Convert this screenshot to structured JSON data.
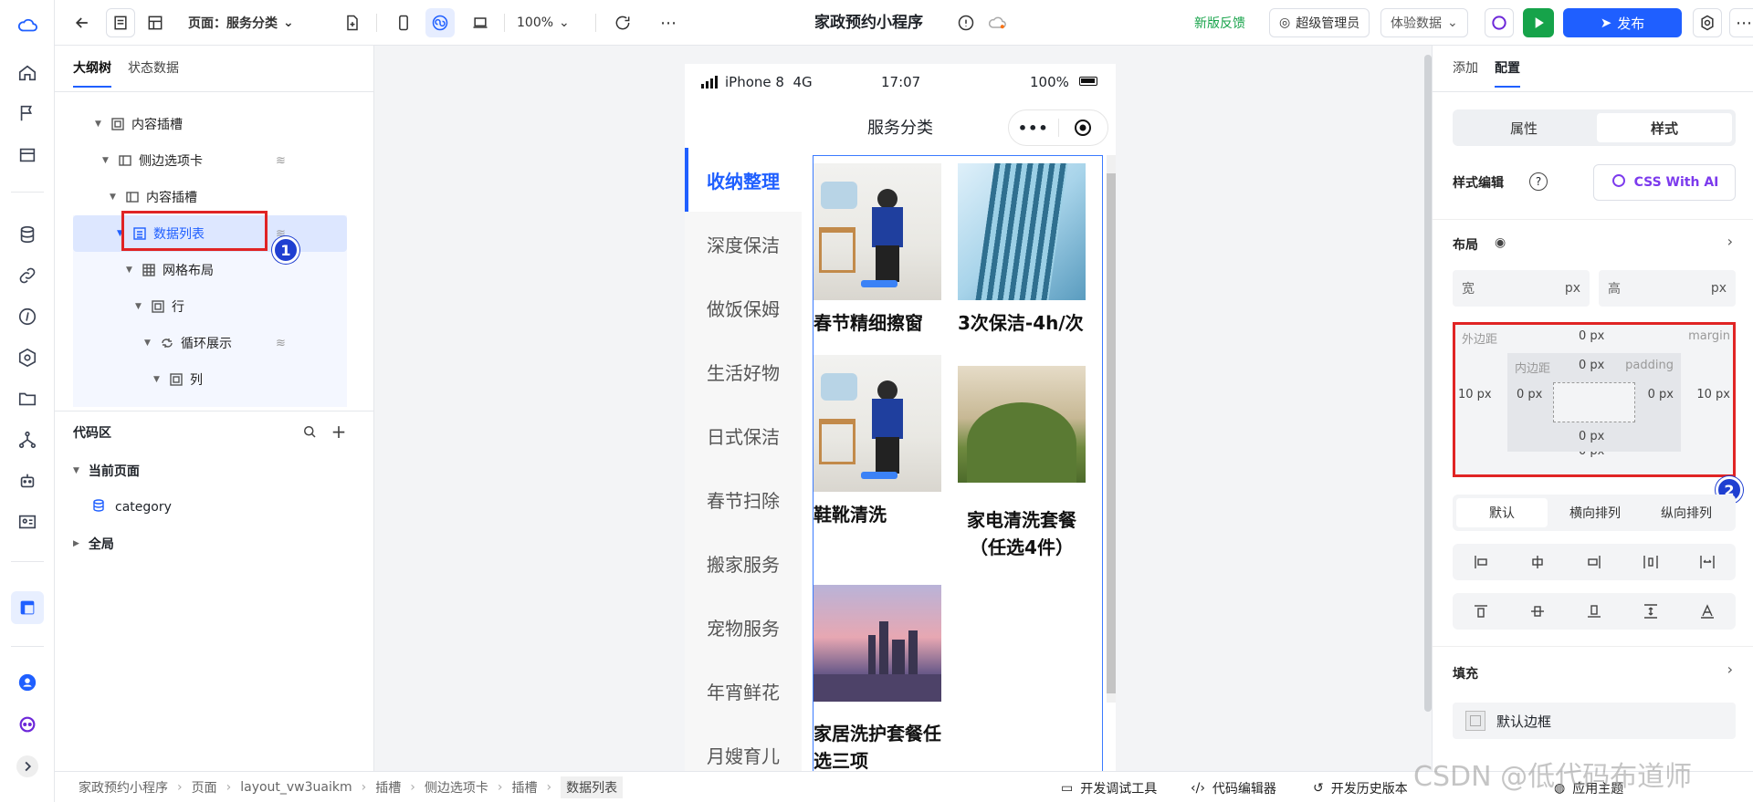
{
  "topbar": {
    "page_selector": "页面：服务分类",
    "zoom": "100%",
    "title": "家政预约小程序",
    "feedback": "新版反馈",
    "role": "超级管理员",
    "data_mode": "体验数据",
    "publish": "发布"
  },
  "left": {
    "tabs": [
      "大纲树",
      "状态数据"
    ],
    "tree": [
      {
        "label": "内容插槽",
        "icon": "slot-icon"
      },
      {
        "label": "侧边选项卡",
        "icon": "tabs-icon",
        "db": true
      },
      {
        "label": "内容插槽",
        "icon": "tabs-icon"
      },
      {
        "label": "数据列表",
        "icon": "list-icon",
        "db": true,
        "selected": true
      },
      {
        "label": "网格布局",
        "icon": "grid-icon"
      },
      {
        "label": "行",
        "icon": "slot-icon"
      },
      {
        "label": "循环展示",
        "icon": "loop-icon",
        "db": true
      },
      {
        "label": "列",
        "icon": "slot-icon"
      }
    ],
    "code": {
      "title": "代码区",
      "current_page": "当前页面",
      "category": "category",
      "global": "全局"
    }
  },
  "phone": {
    "carrier": "iPhone 8  4G",
    "time": "17:07",
    "battery": "100%",
    "nav_title": "服务分类",
    "side_items": [
      "收纳整理",
      "深度保洁",
      "做饭保姆",
      "生活好物",
      "日式保洁",
      "春节扫除",
      "搬家服务",
      "宠物服务",
      "年宵鲜花",
      "月嫂育儿"
    ],
    "cards": [
      {
        "caption": "春节精细擦窗"
      },
      {
        "caption": "3次保洁-4h/次"
      },
      {
        "caption": "鞋靴清洗"
      },
      {
        "caption": "家电清洗套餐（任选4件）"
      },
      {
        "caption": "家居洗护套餐任选三项"
      }
    ]
  },
  "right": {
    "tabs": [
      "添加",
      "配置"
    ],
    "segments": [
      "属性",
      "样式"
    ],
    "style_editor": "样式编辑",
    "css_ai": "CSS With AI",
    "layout": "布局",
    "width_label": "宽",
    "height_label": "高",
    "unit": "px",
    "box": {
      "margin_label": "外边距",
      "margin_en": "margin",
      "padding_label": "内边距",
      "padding_en": "padding",
      "margin_top": "0 px",
      "margin_left": "10 px",
      "margin_right": "10 px",
      "margin_bottom": "0 px",
      "padding_top": "0 px",
      "padding_left": "0 px",
      "padding_right": "0 px",
      "padding_bottom": "0 px"
    },
    "direction": [
      "默认",
      "横向排列",
      "纵向排列"
    ],
    "fill": "填充",
    "default_border": "默认边框"
  },
  "annotations": {
    "badge1": "1",
    "badge2": "2"
  },
  "bottom": {
    "breadcrumb": [
      "家政预约小程序",
      "页面",
      "layout_vw3uaikm",
      "插槽",
      "侧边选项卡",
      "插槽",
      "数据列表"
    ],
    "dev_tools": "开发调试工具",
    "code_editor": "代码编辑器",
    "history": "开发历史版本",
    "theme": "应用主题"
  },
  "watermark": "CSDN @低代码布道师"
}
